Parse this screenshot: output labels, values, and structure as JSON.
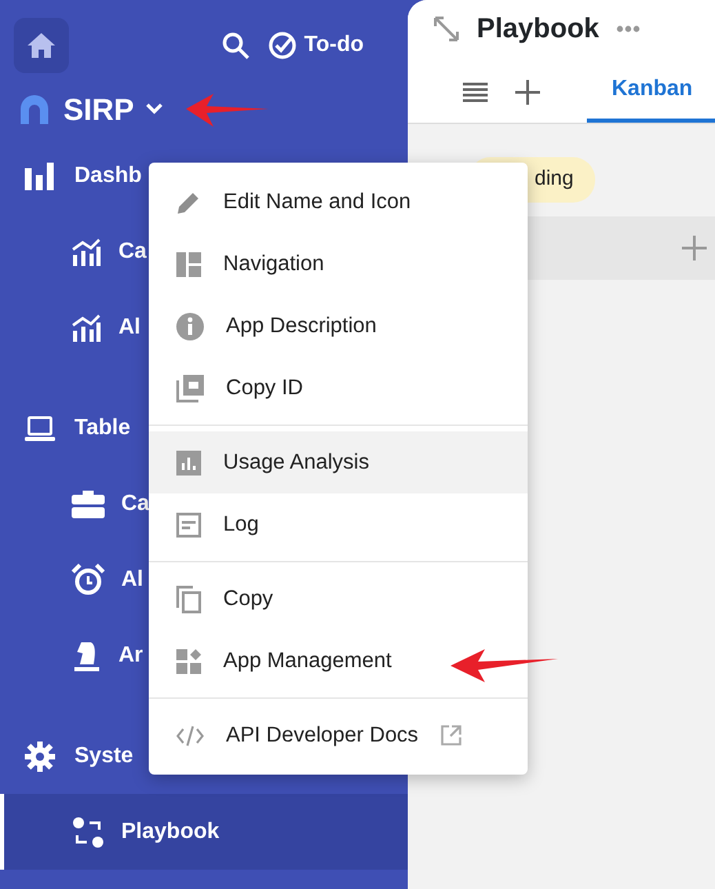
{
  "sidebar": {
    "todo": "To-do",
    "app_name": "SIRP",
    "items": [
      {
        "kind": "section",
        "label": "Dashb",
        "selected": false
      },
      {
        "kind": "sub",
        "label": "Ca",
        "selected": false
      },
      {
        "kind": "sub",
        "label": "Al",
        "selected": false
      },
      {
        "kind": "section",
        "label": "Table",
        "selected": false
      },
      {
        "kind": "sub",
        "label": "Ca",
        "selected": false
      },
      {
        "kind": "sub",
        "label": "Al",
        "selected": false
      },
      {
        "kind": "sub",
        "label": "Ar",
        "selected": false
      },
      {
        "kind": "section",
        "label": "Syste",
        "selected": false
      },
      {
        "kind": "sub",
        "label": "Playbook",
        "selected": true
      }
    ]
  },
  "main": {
    "title": "Playbook",
    "tabs": [
      {
        "label": "Kanban",
        "selected": true
      }
    ],
    "status_tag": "ding"
  },
  "menu": {
    "groups": [
      [
        {
          "label": "Edit Name and Icon",
          "highlighted": false
        },
        {
          "label": "Navigation",
          "highlighted": false
        },
        {
          "label": "App Description",
          "highlighted": false
        },
        {
          "label": "Copy ID",
          "highlighted": false
        }
      ],
      [
        {
          "label": "Usage Analysis",
          "highlighted": true
        },
        {
          "label": "Log",
          "highlighted": false
        }
      ],
      [
        {
          "label": "Copy",
          "highlighted": false
        },
        {
          "label": "App Management",
          "highlighted": false
        }
      ],
      [
        {
          "label": "API Developer Docs",
          "highlighted": false,
          "external": true
        }
      ]
    ]
  }
}
